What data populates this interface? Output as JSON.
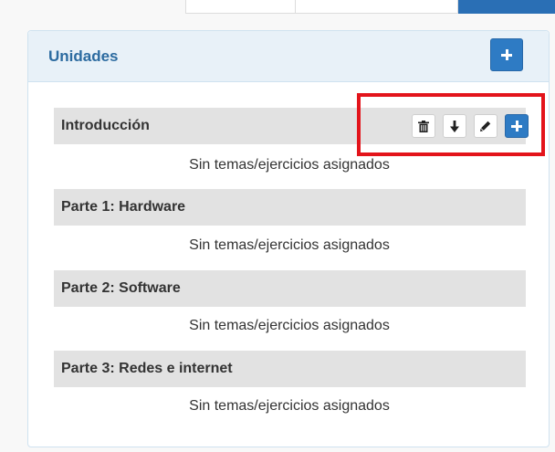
{
  "panel": {
    "title": "Unidades",
    "add_icon": "plus-icon"
  },
  "units": [
    {
      "title": "Introducción",
      "empty_text": "Sin temas/ejercicios asignados"
    },
    {
      "title": "Parte 1: Hardware",
      "empty_text": "Sin temas/ejercicios asignados"
    },
    {
      "title": "Parte 2: Software",
      "empty_text": "Sin temas/ejercicios asignados"
    },
    {
      "title": "Parte 3: Redes e internet",
      "empty_text": "Sin temas/ejercicios asignados"
    }
  ],
  "unit_actions": [
    "trash-icon",
    "arrow-down-icon",
    "pencil-icon",
    "plus-icon"
  ],
  "colors": {
    "accent": "#2e7bc4",
    "header_bg": "#e8f1f8",
    "row_bg": "#e2e2e2",
    "highlight": "#e3141b"
  }
}
